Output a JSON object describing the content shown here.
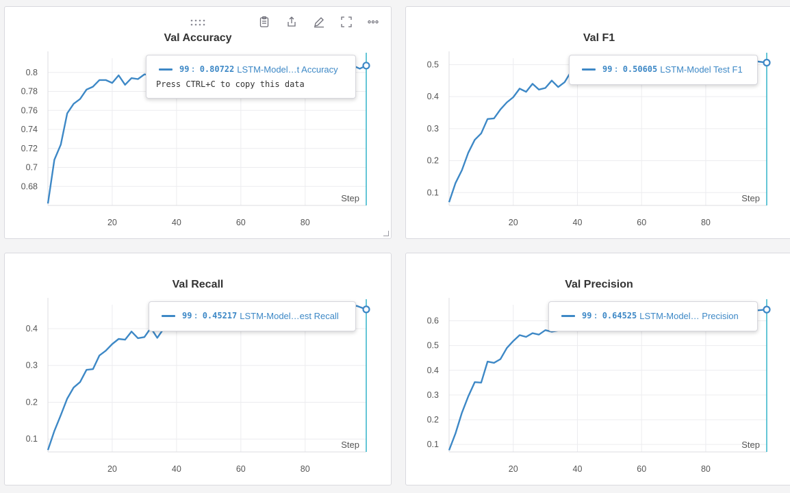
{
  "toolbar": {
    "icons": [
      "drag-handle-icon",
      "clipboard-icon",
      "share-icon",
      "edit-icon",
      "fullscreen-icon",
      "more-icon"
    ]
  },
  "accent_color": "#3d88c6",
  "cursor_color": "#30b4c8",
  "chart_data": [
    {
      "type": "line",
      "title": "Val Accuracy",
      "xlabel": "Step",
      "ylabel": "",
      "ylim": [
        0.66,
        0.815
      ],
      "xlim": [
        0,
        99
      ],
      "x_ticks": [
        20,
        40,
        60,
        80
      ],
      "y_ticks": [
        0.68,
        0.7,
        0.72,
        0.74,
        0.76,
        0.78,
        0.8
      ],
      "y_tick_labels": [
        "0.68",
        "0.7",
        "0.72",
        "0.74",
        "0.76",
        "0.78",
        "0.8"
      ],
      "grid": true,
      "series": [
        {
          "name": "LSTM-Model Test Accuracy",
          "x": [
            0,
            2,
            4,
            6,
            8,
            10,
            12,
            14,
            16,
            18,
            20,
            22,
            24,
            26,
            28,
            30,
            32,
            36,
            40,
            44,
            48,
            52,
            56,
            60,
            64,
            68,
            72,
            76,
            80,
            84,
            88,
            92,
            95,
            97,
            99
          ],
          "y": [
            0.662,
            0.708,
            0.724,
            0.757,
            0.767,
            0.772,
            0.782,
            0.785,
            0.792,
            0.792,
            0.789,
            0.797,
            0.787,
            0.794,
            0.793,
            0.798,
            0.797,
            0.799,
            0.8,
            0.801,
            0.801,
            0.802,
            0.802,
            0.803,
            0.803,
            0.804,
            0.804,
            0.805,
            0.805,
            0.806,
            0.806,
            0.807,
            0.807,
            0.804,
            0.80722
          ]
        }
      ],
      "tooltip": {
        "step": "99",
        "value": "0.80722",
        "series_label": "LSTM-Model…t Accuracy",
        "hint": "Press CTRL+C to copy this data"
      }
    },
    {
      "type": "line",
      "title": "Val F1",
      "xlabel": "Step",
      "ylabel": "",
      "ylim": [
        0.06,
        0.52
      ],
      "xlim": [
        0,
        99
      ],
      "x_ticks": [
        20,
        40,
        60,
        80
      ],
      "y_ticks": [
        0.1,
        0.2,
        0.3,
        0.4,
        0.5
      ],
      "y_tick_labels": [
        "0.1",
        "0.2",
        "0.3",
        "0.4",
        "0.5"
      ],
      "grid": true,
      "series": [
        {
          "name": "LSTM-Model Test F1",
          "x": [
            0,
            2,
            4,
            6,
            8,
            10,
            12,
            14,
            16,
            18,
            20,
            22,
            24,
            26,
            28,
            30,
            32,
            34,
            36,
            38,
            40,
            44,
            48,
            52,
            56,
            60,
            64,
            68,
            72,
            76,
            80,
            84,
            88,
            92,
            96,
            99
          ],
          "y": [
            0.07,
            0.13,
            0.17,
            0.225,
            0.265,
            0.285,
            0.33,
            0.332,
            0.36,
            0.382,
            0.398,
            0.425,
            0.415,
            0.44,
            0.422,
            0.427,
            0.45,
            0.43,
            0.445,
            0.478,
            0.486,
            0.49,
            0.492,
            0.494,
            0.495,
            0.497,
            0.498,
            0.499,
            0.5,
            0.501,
            0.502,
            0.503,
            0.504,
            0.505,
            0.51,
            0.50605
          ]
        }
      ],
      "tooltip": {
        "step": "99",
        "value": "0.50605",
        "series_label": "LSTM-Model Test F1",
        "hint": ""
      }
    },
    {
      "type": "line",
      "title": "Val Recall",
      "xlabel": "Step",
      "ylabel": "",
      "ylim": [
        0.065,
        0.465
      ],
      "xlim": [
        0,
        99
      ],
      "x_ticks": [
        20,
        40,
        60,
        80
      ],
      "y_ticks": [
        0.1,
        0.2,
        0.3,
        0.4
      ],
      "y_tick_labels": [
        "0.1",
        "0.2",
        "0.3",
        "0.4"
      ],
      "grid": true,
      "series": [
        {
          "name": "LSTM-Model Test Recall",
          "x": [
            0,
            2,
            4,
            6,
            8,
            10,
            12,
            14,
            16,
            18,
            20,
            22,
            24,
            26,
            28,
            30,
            32,
            34,
            36,
            40,
            44,
            48,
            52,
            56,
            60,
            64,
            68,
            72,
            76,
            80,
            84,
            88,
            92,
            96,
            99
          ],
          "y": [
            0.07,
            0.122,
            0.165,
            0.21,
            0.24,
            0.255,
            0.288,
            0.29,
            0.327,
            0.34,
            0.358,
            0.372,
            0.37,
            0.392,
            0.374,
            0.377,
            0.402,
            0.375,
            0.4,
            0.41,
            0.418,
            0.423,
            0.428,
            0.432,
            0.436,
            0.439,
            0.442,
            0.444,
            0.446,
            0.448,
            0.449,
            0.45,
            0.451,
            0.462,
            0.45217
          ]
        }
      ],
      "tooltip": {
        "step": "99",
        "value": "0.45217",
        "series_label": "LSTM-Model…est Recall",
        "hint": ""
      }
    },
    {
      "type": "line",
      "title": "Val Precision",
      "xlabel": "Step",
      "ylabel": "",
      "ylim": [
        0.07,
        0.665
      ],
      "xlim": [
        0,
        99
      ],
      "x_ticks": [
        20,
        40,
        60,
        80
      ],
      "y_ticks": [
        0.1,
        0.2,
        0.3,
        0.4,
        0.5,
        0.6
      ],
      "y_tick_labels": [
        "0.1",
        "0.2",
        "0.3",
        "0.4",
        "0.5",
        "0.6"
      ],
      "grid": true,
      "series": [
        {
          "name": "LSTM-Model Test Precision",
          "x": [
            0,
            2,
            4,
            6,
            8,
            10,
            12,
            14,
            16,
            18,
            20,
            22,
            24,
            26,
            28,
            30,
            32,
            36,
            40,
            44,
            48,
            52,
            56,
            60,
            64,
            68,
            72,
            76,
            80,
            84,
            88,
            92,
            96,
            99
          ],
          "y": [
            0.077,
            0.145,
            0.228,
            0.295,
            0.352,
            0.35,
            0.435,
            0.43,
            0.445,
            0.49,
            0.518,
            0.542,
            0.535,
            0.55,
            0.544,
            0.562,
            0.556,
            0.565,
            0.575,
            0.585,
            0.592,
            0.6,
            0.606,
            0.612,
            0.617,
            0.622,
            0.626,
            0.63,
            0.633,
            0.636,
            0.638,
            0.641,
            0.642,
            0.64525
          ]
        }
      ],
      "tooltip": {
        "step": "99",
        "value": "0.64525",
        "series_label": "LSTM-Model… Precision",
        "hint": ""
      }
    }
  ]
}
